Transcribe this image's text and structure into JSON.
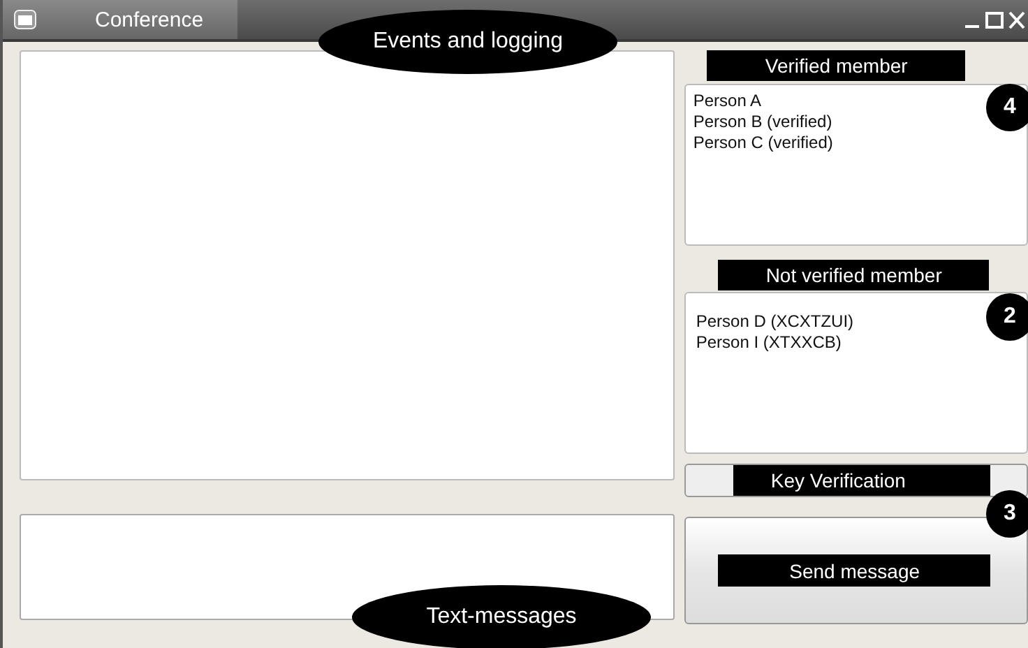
{
  "window": {
    "title": "Conference"
  },
  "callouts": [
    {
      "text": "Events and logging",
      "kind": "top"
    },
    {
      "text": "Text-messages",
      "kind": "bottom"
    }
  ],
  "verified": {
    "label": "Verified member",
    "badge": "4",
    "members": [
      "Person A",
      "Person B (verified)",
      "Person C (verified)"
    ]
  },
  "not_verified": {
    "label": "Not verified member",
    "badge": "2",
    "members": [
      "Person D (XCXTZUI)",
      "Person I (XTXXCB)"
    ]
  },
  "key_verification": {
    "label": "Key Verification"
  },
  "send": {
    "label": "Send message",
    "badge": "3"
  }
}
